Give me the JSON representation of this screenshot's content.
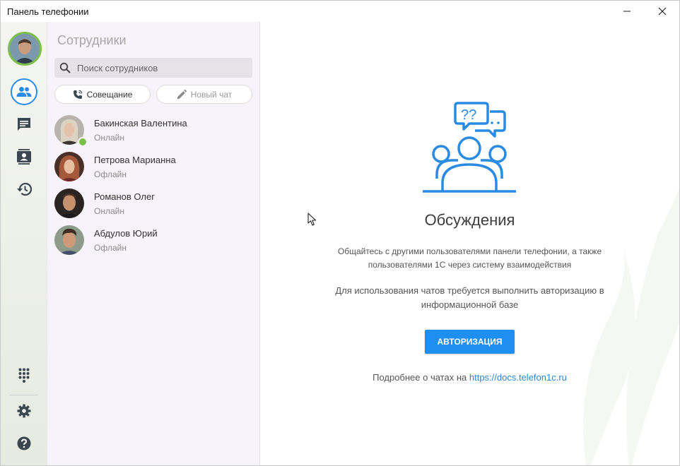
{
  "window": {
    "title": "Панель телефонии",
    "min_icon": "minimize-icon",
    "close_icon": "close-icon"
  },
  "rail": {
    "items": [
      {
        "name": "contacts",
        "icon": "people-icon",
        "active": true
      },
      {
        "name": "chats",
        "icon": "chat-icon"
      },
      {
        "name": "address-book",
        "icon": "contact-card-icon"
      },
      {
        "name": "history",
        "icon": "history-icon"
      },
      {
        "name": "dialpad",
        "icon": "dialpad-icon"
      },
      {
        "name": "settings",
        "icon": "gear-icon"
      },
      {
        "name": "help",
        "icon": "help-icon"
      }
    ],
    "accent": "#2a8be4",
    "online_color": "#7cc04b"
  },
  "contacts": {
    "title": "Сотрудники",
    "search_placeholder": "Поиск сотрудников",
    "meeting_label": "Совещание",
    "new_chat_label": "Новый чат",
    "employees": [
      {
        "name": "Бакинская Валентина",
        "status": "Онлайн",
        "online_dot": true
      },
      {
        "name": "Петрова Марианна",
        "status": "Офлайн",
        "online_dot": false
      },
      {
        "name": "Романов Олег",
        "status": "Онлайн",
        "online_dot": false
      },
      {
        "name": "Абдулов Юрий",
        "status": "Офлайн",
        "online_dot": false
      }
    ]
  },
  "main": {
    "heading": "Обсуждения",
    "description": "Общайтесь с другими пользователями панели телефонии, а также пользователями 1С через систему взаимодействия",
    "auth_note": "Для использования чатов требуется выполнить авторизацию в информационной базе",
    "auth_button": "АВТОРИЗАЦИЯ",
    "more_prefix": "Подробнее о чатах на",
    "more_link": "https://docs.telefon1c.ru",
    "button_color": "#1e8ef0"
  }
}
